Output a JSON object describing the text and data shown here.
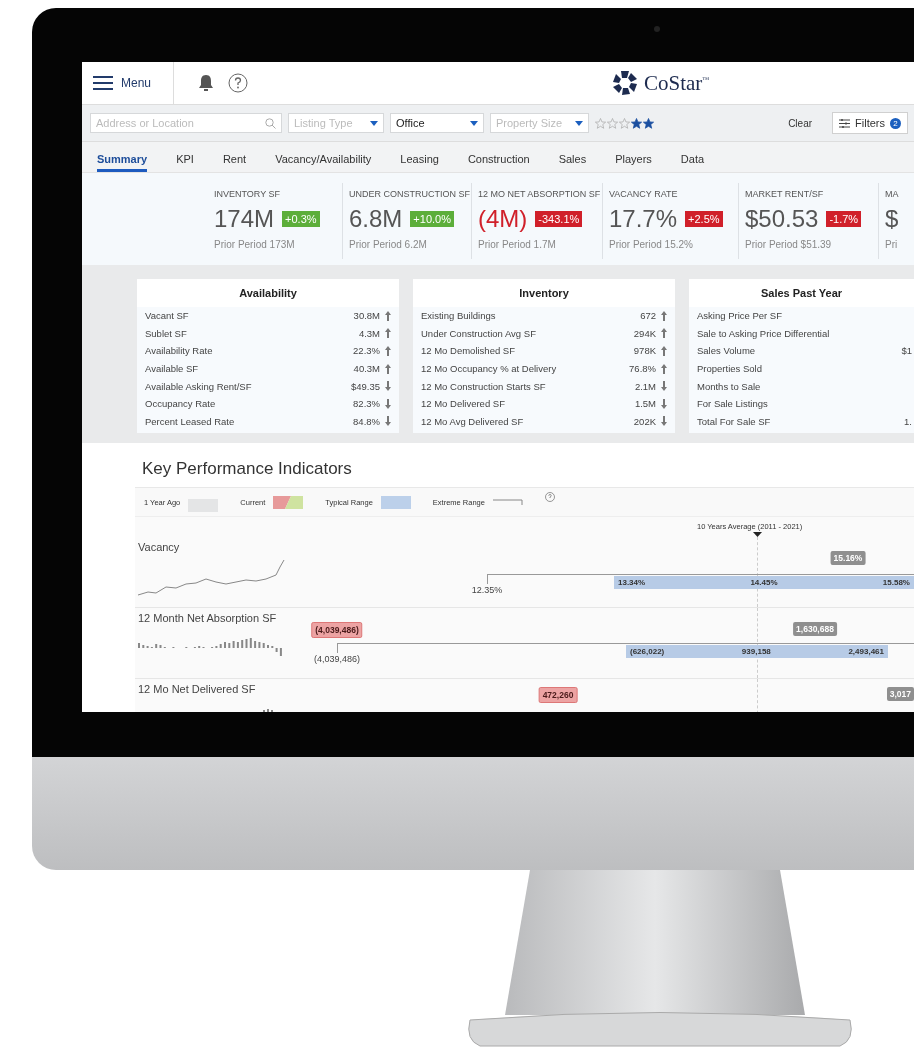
{
  "header": {
    "menu_label": "Menu",
    "logo_text": "CoStar",
    "logo_mark": "™"
  },
  "filters": {
    "search_placeholder": "Address or Location",
    "listing_type_placeholder": "Listing Type",
    "property_type_value": "Office",
    "property_size_placeholder": "Property Size",
    "stars": 2,
    "clear_label": "Clear",
    "filters_label": "Filters",
    "filters_count": "2"
  },
  "tabs": [
    {
      "label": "Summary",
      "selected": true
    },
    {
      "label": "KPI",
      "selected": false
    },
    {
      "label": "Rent",
      "selected": false
    },
    {
      "label": "Vacancy/Availability",
      "selected": false
    },
    {
      "label": "Leasing",
      "selected": false
    },
    {
      "label": "Construction",
      "selected": false
    },
    {
      "label": "Sales",
      "selected": false
    },
    {
      "label": "Players",
      "selected": false
    },
    {
      "label": "Data",
      "selected": false
    }
  ],
  "stats": [
    {
      "label": "INVENTORY SF",
      "value": "174M",
      "value_negative": false,
      "change": "+0.3%",
      "positive": true,
      "prior": "Prior Period 173M"
    },
    {
      "label": "UNDER CONSTRUCTION SF",
      "value": "6.8M",
      "value_negative": false,
      "change": "+10.0%",
      "positive": true,
      "prior": "Prior Period 6.2M"
    },
    {
      "label": "12 MO NET ABSORPTION SF",
      "value": "(4M)",
      "value_negative": true,
      "change": "-343.1%",
      "positive": false,
      "prior": "Prior Period 1.7M"
    },
    {
      "label": "VACANCY RATE",
      "value": "17.7%",
      "value_negative": false,
      "change": "+2.5%",
      "positive": false,
      "prior": "Prior Period 15.2%"
    },
    {
      "label": "MARKET RENT/SF",
      "value": "$50.53",
      "value_negative": false,
      "change": "-1.7%",
      "positive": false,
      "prior": "Prior Period $51.39"
    },
    {
      "label": "MA",
      "value": "$",
      "value_negative": false,
      "prior": "Pri"
    }
  ],
  "tables": [
    {
      "title": "Availability",
      "rows": [
        {
          "label": "Vacant SF",
          "value": "30.8M",
          "rising": true
        },
        {
          "label": "Sublet SF",
          "value": "4.3M",
          "rising": true
        },
        {
          "label": "Availability Rate",
          "value": "22.3%",
          "rising": true
        },
        {
          "label": "Available SF",
          "value": "40.3M",
          "rising": true
        },
        {
          "label": "Available Asking Rent/SF",
          "value": "$49.35",
          "rising": false
        },
        {
          "label": "Occupancy Rate",
          "value": "82.3%",
          "rising": false
        },
        {
          "label": "Percent Leased Rate",
          "value": "84.8%",
          "rising": false
        }
      ]
    },
    {
      "title": "Inventory",
      "rows": [
        {
          "label": "Existing Buildings",
          "value": "672",
          "rising": true
        },
        {
          "label": "Under Construction Avg SF",
          "value": "294K",
          "rising": true
        },
        {
          "label": "12 Mo Demolished SF",
          "value": "978K",
          "rising": true
        },
        {
          "label": "12 Mo Occupancy % at Delivery",
          "value": "76.8%",
          "rising": true
        },
        {
          "label": "12 Mo Construction Starts SF",
          "value": "2.1M",
          "rising": false
        },
        {
          "label": "12 Mo Delivered SF",
          "value": "1.5M",
          "rising": false
        },
        {
          "label": "12 Mo Avg Delivered SF",
          "value": "202K",
          "rising": false
        }
      ]
    },
    {
      "title": "Sales Past Year",
      "rows": [
        {
          "label": "Asking Price Per SF"
        },
        {
          "label": "Sale to Asking Price Differential"
        },
        {
          "label": "Sales Volume",
          "value": "$1"
        },
        {
          "label": "Properties Sold"
        },
        {
          "label": "Months to Sale"
        },
        {
          "label": "For Sale Listings"
        },
        {
          "label": "Total For Sale SF",
          "value": "1."
        }
      ]
    }
  ],
  "kpi": {
    "title": "Key Performance Indicators",
    "legend": [
      {
        "label": "1 Year Ago",
        "kind": "prior"
      },
      {
        "label": "Current",
        "kind": "current"
      },
      {
        "label": "Typical Range",
        "kind": "typical"
      },
      {
        "label": "Extreme Range",
        "kind": "extreme"
      }
    ],
    "average_label": "10 Years Average (2011 - 2021)",
    "rows": [
      {
        "name": "Vacancy",
        "prior_tag": "15.16%",
        "extreme_low": "12.35%",
        "typical_labels": [
          "13.34%",
          "14.45%",
          "15.58%"
        ]
      },
      {
        "name": "12 Month Net Absorption SF",
        "current_tag": "(4,039,486)",
        "prior_tag": "1,630,688",
        "extreme_low": "(4,039,486)",
        "typical_labels": [
          "(626,022)",
          "939,158",
          "2,493,461"
        ]
      },
      {
        "name": "12 Mo Net Delivered SF",
        "current_tag": "472,260",
        "prior_tag": "3,017"
      }
    ]
  }
}
